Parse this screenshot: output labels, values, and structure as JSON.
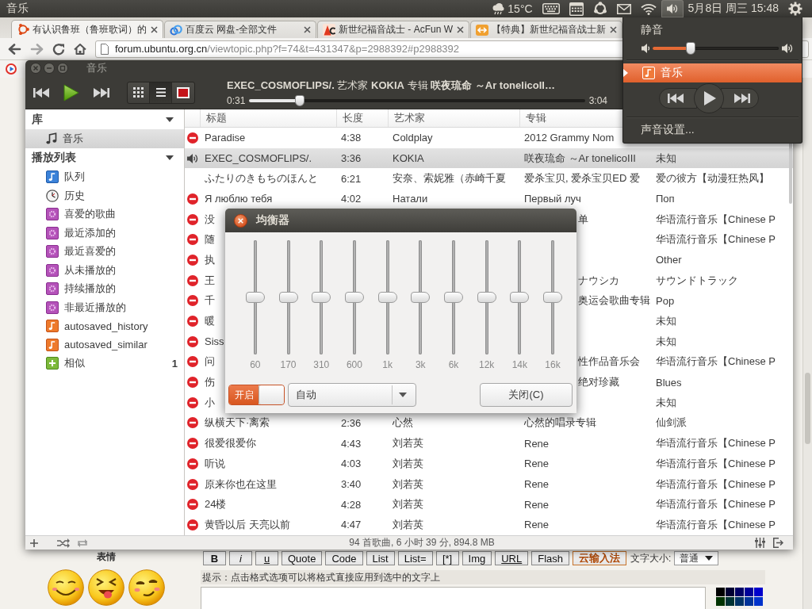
{
  "top_panel": {
    "app_title": "音乐",
    "weather": "15°C",
    "clock": "5月8日 周三 15:48"
  },
  "browser": {
    "tabs": [
      {
        "title": "有认识鲁班（鲁班歌词）的",
        "selected": true
      },
      {
        "title": "百度云 网盘-全部文件",
        "selected": false
      },
      {
        "title": "新世纪福音战士 - AcFun W",
        "selected": false
      },
      {
        "title": "【特典】新世纪福音战士新",
        "selected": false
      }
    ],
    "address": {
      "host": "forum.ubuntu.org.cn",
      "path": "/viewtopic.php?f=74&t=431347&p=2988392#p2988392"
    },
    "page": {
      "emoticons_label": "表情",
      "format_buttons": [
        {
          "label": "B",
          "kind": "bold"
        },
        {
          "label": "i",
          "kind": "italic"
        },
        {
          "label": "u",
          "kind": "underline"
        },
        {
          "label": "Quote",
          "kind": "plain"
        },
        {
          "label": "Code",
          "kind": "plain"
        },
        {
          "label": "List",
          "kind": "plain"
        },
        {
          "label": "List=",
          "kind": "plain"
        },
        {
          "label": "[*]",
          "kind": "plain"
        },
        {
          "label": "Img",
          "kind": "plain"
        },
        {
          "label": "URL",
          "kind": "underline"
        },
        {
          "label": "Flash",
          "kind": "plain"
        },
        {
          "label": "云输入法",
          "kind": "accent"
        }
      ],
      "font_size": {
        "label": "文字大小:",
        "value": "普通"
      },
      "hint": "提示：点击格式选项可以将格式直接应用到选中的文字上",
      "palette": [
        {
          "color": "#000000"
        },
        {
          "color": "#000033"
        },
        {
          "color": "#000066"
        },
        {
          "color": "#000099"
        },
        {
          "color": "#0000cc"
        },
        {
          "color": "#003300"
        },
        {
          "color": "#003333"
        },
        {
          "color": "#003366"
        },
        {
          "color": "#003399"
        },
        {
          "color": "#0033cc"
        }
      ]
    }
  },
  "player": {
    "title": "音乐",
    "now_playing": "**EXEC_COSMOFLIPS/.** 艺术家 **KOKIA** 专辑 **咲夜琉命 ～Ar tonelicoII…**",
    "elapsed": "0:31",
    "duration": "3:04",
    "progress": {
      "level": 0.15
    },
    "view_buttons": [
      {
        "selected": false
      },
      {
        "selected": true
      },
      {
        "selected": false
      }
    ],
    "sidebar": [
      {
        "title": "库",
        "expanded": true,
        "items": [
          {
            "label": "音乐",
            "kind": "music",
            "selected": true
          }
        ]
      },
      {
        "title": "播放列表",
        "expanded": true,
        "items": [
          {
            "label": "队列",
            "kind": "queue",
            "selected": false
          },
          {
            "label": "历史",
            "kind": "history",
            "selected": false
          },
          {
            "label": "喜爱的歌曲",
            "kind": "smart",
            "selected": false
          },
          {
            "label": "最近添加的",
            "kind": "smart",
            "selected": false
          },
          {
            "label": "最近喜爱的",
            "kind": "smart",
            "selected": false
          },
          {
            "label": "从未播放的",
            "kind": "smart",
            "selected": false
          },
          {
            "label": "持续播放的",
            "kind": "smart",
            "selected": false
          },
          {
            "label": "非最近播放的",
            "kind": "smart",
            "selected": false
          },
          {
            "label": "autosaved_history",
            "kind": "auto",
            "selected": false
          },
          {
            "label": "autosaved_similar",
            "kind": "auto",
            "selected": false
          },
          {
            "label": "相似",
            "kind": "related",
            "selected": false,
            "count": "1"
          }
        ]
      }
    ],
    "table": {
      "columns": [
        "标题",
        "长度",
        "艺术家",
        "专辑"
      ],
      "rows": [
        {
          "kind": "full",
          "error": true,
          "playing": false,
          "selected": false,
          "title": "Paradise",
          "length": "4:38",
          "artist": "Coldplay",
          "album": "2012 Grammy Nom"
        },
        {
          "kind": "full",
          "error": false,
          "playing": true,
          "selected": true,
          "title": "EXEC_COSMOFLIPS/.",
          "length": "3:36",
          "artist": "KOKIA",
          "album": "咲夜琉命 ～Ar tonelicoIII",
          "column_5": "未知"
        },
        {
          "kind": "full",
          "error": false,
          "playing": false,
          "selected": false,
          "title": "ふたりのきもちのほんと",
          "length": "6:21",
          "artist": "安奈、索妮雅（赤崎千夏",
          "album": "爱杀宝贝, 爱杀宝贝ED 爱",
          "column_5": "爱の彼方【动漫狂热风】"
        },
        {
          "kind": "full",
          "error": true,
          "playing": false,
          "selected": false,
          "title": "Я люблю тебя",
          "length": "4:02",
          "artist": "Натали",
          "album": "Первый луч",
          "column_5": "Поп"
        },
        {
          "kind": "covered",
          "error": true,
          "playing": false,
          "selected": false,
          "title": "没",
          "album": "单",
          "column_5": "华语流行音乐【Chinese P"
        },
        {
          "kind": "covered",
          "error": true,
          "playing": false,
          "selected": false,
          "title": "随",
          "column_5": "华语流行音乐【Chinese P"
        },
        {
          "kind": "covered",
          "error": true,
          "playing": false,
          "selected": false,
          "title": "执",
          "column_5": "Other"
        },
        {
          "kind": "covered",
          "error": true,
          "playing": false,
          "selected": false,
          "title": "王",
          "album": "ナウシカ",
          "column_5": "サウンドトラック"
        },
        {
          "kind": "covered",
          "error": true,
          "playing": false,
          "selected": false,
          "title": "千",
          "album": "奥运会歌曲专辑",
          "column_5": "Pop"
        },
        {
          "kind": "covered",
          "error": true,
          "playing": false,
          "selected": false,
          "title": "暖",
          "column_5": "未知"
        },
        {
          "kind": "covered",
          "error": true,
          "playing": false,
          "selected": false,
          "title": "Siss",
          "column_5": "未知"
        },
        {
          "kind": "covered",
          "error": true,
          "playing": false,
          "selected": false,
          "title": "问",
          "album": "性作品音乐会",
          "column_5": "华语流行音乐【Chinese P"
        },
        {
          "kind": "covered",
          "error": true,
          "playing": false,
          "selected": false,
          "title": "伤",
          "album": "绝对珍藏",
          "column_5": "Blues"
        },
        {
          "kind": "covered",
          "error": true,
          "playing": false,
          "selected": false,
          "title": "小",
          "column_5": "未知"
        },
        {
          "kind": "full",
          "error": true,
          "playing": false,
          "selected": false,
          "title": "纵横天下·离索",
          "length": "2:36",
          "artist": "心然",
          "album": "心然的唱录专辑",
          "column_5": "仙剑派"
        },
        {
          "kind": "full",
          "error": true,
          "playing": false,
          "selected": false,
          "title": "很爱很爱你",
          "length": "4:43",
          "artist": "刘若英",
          "album": "Rene",
          "column_5": "华语流行音乐【Chinese P"
        },
        {
          "kind": "full",
          "error": true,
          "playing": false,
          "selected": false,
          "title": "听说",
          "length": "4:03",
          "artist": "刘若英",
          "album": "Rene",
          "column_5": "华语流行音乐【Chinese P"
        },
        {
          "kind": "full",
          "error": true,
          "playing": false,
          "selected": false,
          "title": "原来你也在这里",
          "length": "3:40",
          "artist": "刘若英",
          "album": "Rene",
          "column_5": "华语流行音乐【Chinese P"
        },
        {
          "kind": "full",
          "error": true,
          "playing": false,
          "selected": false,
          "title": "24楼",
          "length": "4:28",
          "artist": "刘若英",
          "album": "Rene",
          "column_5": "华语流行音乐【Chinese P"
        },
        {
          "kind": "full",
          "error": true,
          "playing": false,
          "selected": false,
          "title": "黄昏以后 天亮以前",
          "length": "4:47",
          "artist": "刘若英",
          "album": "Rene",
          "column_5": "华语流行音乐【Chinese P"
        }
      ]
    },
    "status_bar": "94 首歌曲, 6 小时 39 分, 894.8 MB"
  },
  "equalizer": {
    "title": "均衡器",
    "bands": [
      {
        "label": "60",
        "level": 0.5
      },
      {
        "label": "170",
        "level": 0.5
      },
      {
        "label": "310",
        "level": 0.5
      },
      {
        "label": "600",
        "level": 0.5
      },
      {
        "label": "1k",
        "level": 0.5
      },
      {
        "label": "3k",
        "level": 0.5
      },
      {
        "label": "6k",
        "level": 0.5
      },
      {
        "label": "12k",
        "level": 0.5
      },
      {
        "label": "14k",
        "level": 0.5
      },
      {
        "label": "16k",
        "level": 0.5
      }
    ],
    "switch": {
      "label": "开启",
      "on": true
    },
    "preset": {
      "value": "自动"
    },
    "close_button": "关闭(C)"
  },
  "sound_menu": {
    "open": true,
    "mute_label": "静音",
    "volume": {
      "level": 0.3
    },
    "player_item": {
      "label": "音乐",
      "selected": true
    },
    "settings_label": "声音设置..."
  }
}
